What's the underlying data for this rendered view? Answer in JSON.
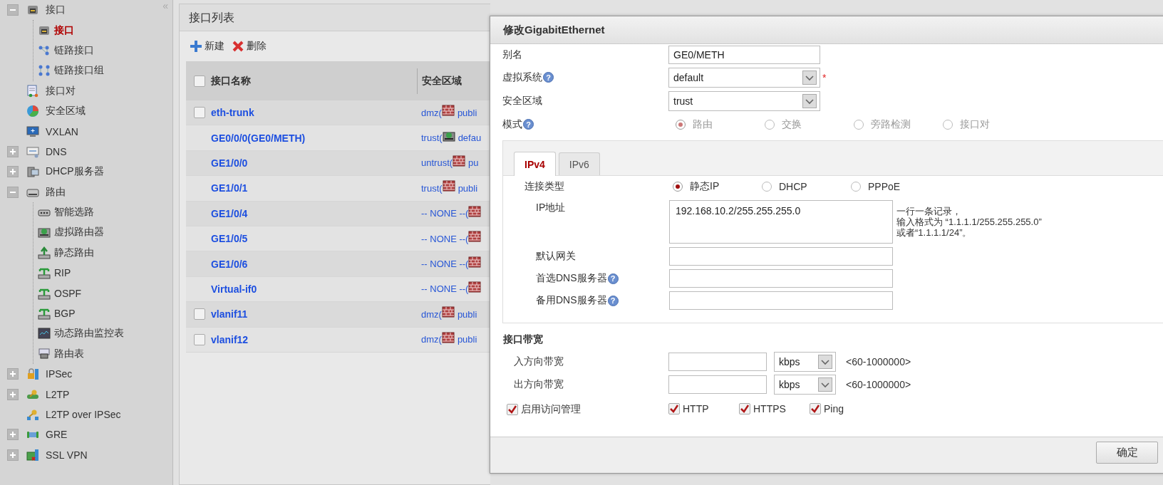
{
  "sidebar": {
    "collapse_glyph": "«",
    "items": [
      {
        "label": "接口",
        "kind": "group",
        "expanded": true,
        "selected": false,
        "children": [
          {
            "label": "接口",
            "selected": true
          },
          {
            "label": "链路接口",
            "selected": false
          },
          {
            "label": "链路接口组",
            "selected": false
          }
        ]
      },
      {
        "label": "接口对",
        "kind": "leaf",
        "selected": false
      },
      {
        "label": "安全区域",
        "kind": "leaf",
        "selected": false
      },
      {
        "label": "VXLAN",
        "kind": "leaf",
        "selected": false
      },
      {
        "label": "DNS",
        "kind": "group",
        "expanded": false,
        "selected": false
      },
      {
        "label": "DHCP服务器",
        "kind": "group",
        "expanded": false,
        "selected": false
      },
      {
        "label": "路由",
        "kind": "group",
        "expanded": true,
        "selected": false,
        "children": [
          {
            "label": "智能选路",
            "selected": false
          },
          {
            "label": "虚拟路由器",
            "selected": false
          },
          {
            "label": "静态路由",
            "selected": false
          },
          {
            "label": "RIP",
            "selected": false
          },
          {
            "label": "OSPF",
            "selected": false
          },
          {
            "label": "BGP",
            "selected": false
          },
          {
            "label": "动态路由监控表",
            "selected": false
          },
          {
            "label": "路由表",
            "selected": false
          }
        ]
      },
      {
        "label": "IPSec",
        "kind": "group",
        "expanded": false,
        "selected": false
      },
      {
        "label": "L2TP",
        "kind": "group",
        "expanded": false,
        "selected": false
      },
      {
        "label": "L2TP over IPSec",
        "kind": "leaf",
        "selected": false
      },
      {
        "label": "GRE",
        "kind": "group",
        "expanded": false,
        "selected": false
      },
      {
        "label": "SSL VPN",
        "kind": "group",
        "expanded": false,
        "selected": false
      }
    ]
  },
  "list": {
    "title": "接口列表",
    "toolbar": [
      "新建",
      "删除"
    ],
    "table": {
      "columns": [
        "接口名称",
        "安全区域"
      ],
      "all_checked": false,
      "rows": [
        {
          "name": "eth-trunk",
          "kind": "selectable",
          "checked": false,
          "zone": {
            "text": "dmz(",
            "kind": "firewall",
            "vsys": "publi"
          }
        },
        {
          "name": "GE0/0/0(GE0/METH)",
          "kind": "fixed",
          "zone": {
            "text": "trust(",
            "kind": "virtual",
            "vsys": "defau"
          }
        },
        {
          "name": "GE1/0/0",
          "kind": "fixed",
          "zone": {
            "text": "untrust(",
            "kind": "firewall",
            "vsys": "pu"
          }
        },
        {
          "name": "GE1/0/1",
          "kind": "fixed",
          "zone": {
            "text": "trust(",
            "kind": "firewall",
            "vsys": "publi"
          }
        },
        {
          "name": "GE1/0/4",
          "kind": "fixed",
          "zone": {
            "text": "-- NONE --(",
            "kind": "firewall"
          }
        },
        {
          "name": "GE1/0/5",
          "kind": "fixed",
          "zone": {
            "text": "-- NONE --(",
            "kind": "firewall"
          }
        },
        {
          "name": "GE1/0/6",
          "kind": "fixed",
          "zone": {
            "text": "-- NONE --(",
            "kind": "firewall"
          }
        },
        {
          "name": "Virtual-if0",
          "kind": "fixed",
          "zone": {
            "text": "-- NONE --(",
            "kind": "firewall"
          }
        },
        {
          "name": "vlanif11",
          "kind": "selectable",
          "checked": false,
          "zone": {
            "text": "dmz(",
            "kind": "firewall",
            "vsys": "publi"
          }
        },
        {
          "name": "vlanif12",
          "kind": "selectable",
          "checked": false,
          "zone": {
            "text": "dmz(",
            "kind": "firewall",
            "vsys": "publi"
          }
        }
      ]
    }
  },
  "dialog": {
    "title": "修改GigabitEthernet",
    "help_glyph": "?",
    "required_mark": "*",
    "fields": [
      {
        "label": "别名",
        "kind": "text",
        "value": "GE0/METH",
        "help": false,
        "required": false
      },
      {
        "label": "虚拟系统",
        "kind": "select",
        "value": "default",
        "help": true,
        "required": true
      },
      {
        "label": "安全区域",
        "kind": "select",
        "value": "trust",
        "help": false,
        "required": false
      }
    ],
    "mode": {
      "label": "模式",
      "help": true,
      "disabled": true,
      "options": [
        {
          "label": "路由",
          "selected": true
        },
        {
          "label": "交换",
          "selected": false
        },
        {
          "label": "旁路检测",
          "selected": false
        },
        {
          "label": "接口对",
          "selected": false
        }
      ]
    },
    "tabs": [
      {
        "label": "IPv4",
        "selected": true
      },
      {
        "label": "IPv6",
        "selected": false
      }
    ],
    "connection": {
      "label": "连接类型",
      "options": [
        {
          "label": "静态IP",
          "selected": true
        },
        {
          "label": "DHCP",
          "selected": false
        },
        {
          "label": "PPPoE",
          "selected": false
        }
      ]
    },
    "ip": {
      "label": "IP地址",
      "value": "192.168.10.2/255.255.255.0",
      "hint": [
        "一行一条记录，",
        "输入格式为 “1.1.1.1/255.255.255.0”",
        "或者“1.1.1.1/24”。"
      ]
    },
    "ip_fields": [
      {
        "label": "默认网关",
        "help": false
      },
      {
        "label": "首选DNS服务器",
        "help": true
      },
      {
        "label": "备用DNS服务器",
        "help": true
      }
    ],
    "bandwidth": {
      "title": "接口带宽",
      "rows": [
        {
          "label": "入方向带宽",
          "unit": "kbps",
          "range": "<60-1000000>"
        },
        {
          "label": "出方向带宽",
          "unit": "kbps",
          "range": "<60-1000000>"
        }
      ]
    },
    "access": [
      {
        "label": "启用访问管理",
        "checked": true
      },
      {
        "label": "HTTP",
        "checked": true
      },
      {
        "label": "HTTPS",
        "checked": true
      },
      {
        "label": "Ping",
        "checked": true
      }
    ],
    "ok": "确定"
  }
}
